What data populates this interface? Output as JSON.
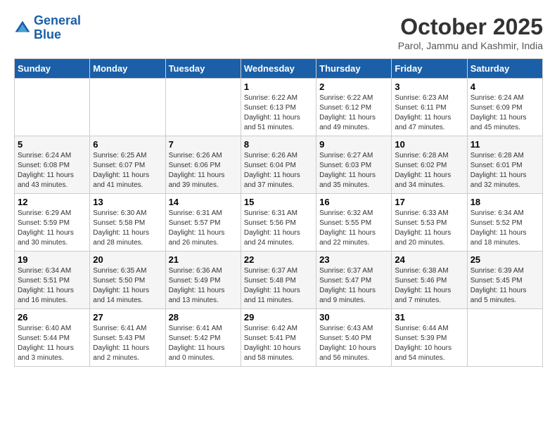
{
  "header": {
    "logo_line1": "General",
    "logo_line2": "Blue",
    "month": "October 2025",
    "location": "Parol, Jammu and Kashmir, India"
  },
  "weekdays": [
    "Sunday",
    "Monday",
    "Tuesday",
    "Wednesday",
    "Thursday",
    "Friday",
    "Saturday"
  ],
  "weeks": [
    [
      {
        "day": "",
        "sunrise": "",
        "sunset": "",
        "daylight": ""
      },
      {
        "day": "",
        "sunrise": "",
        "sunset": "",
        "daylight": ""
      },
      {
        "day": "",
        "sunrise": "",
        "sunset": "",
        "daylight": ""
      },
      {
        "day": "1",
        "sunrise": "Sunrise: 6:22 AM",
        "sunset": "Sunset: 6:13 PM",
        "daylight": "Daylight: 11 hours and 51 minutes."
      },
      {
        "day": "2",
        "sunrise": "Sunrise: 6:22 AM",
        "sunset": "Sunset: 6:12 PM",
        "daylight": "Daylight: 11 hours and 49 minutes."
      },
      {
        "day": "3",
        "sunrise": "Sunrise: 6:23 AM",
        "sunset": "Sunset: 6:11 PM",
        "daylight": "Daylight: 11 hours and 47 minutes."
      },
      {
        "day": "4",
        "sunrise": "Sunrise: 6:24 AM",
        "sunset": "Sunset: 6:09 PM",
        "daylight": "Daylight: 11 hours and 45 minutes."
      }
    ],
    [
      {
        "day": "5",
        "sunrise": "Sunrise: 6:24 AM",
        "sunset": "Sunset: 6:08 PM",
        "daylight": "Daylight: 11 hours and 43 minutes."
      },
      {
        "day": "6",
        "sunrise": "Sunrise: 6:25 AM",
        "sunset": "Sunset: 6:07 PM",
        "daylight": "Daylight: 11 hours and 41 minutes."
      },
      {
        "day": "7",
        "sunrise": "Sunrise: 6:26 AM",
        "sunset": "Sunset: 6:06 PM",
        "daylight": "Daylight: 11 hours and 39 minutes."
      },
      {
        "day": "8",
        "sunrise": "Sunrise: 6:26 AM",
        "sunset": "Sunset: 6:04 PM",
        "daylight": "Daylight: 11 hours and 37 minutes."
      },
      {
        "day": "9",
        "sunrise": "Sunrise: 6:27 AM",
        "sunset": "Sunset: 6:03 PM",
        "daylight": "Daylight: 11 hours and 35 minutes."
      },
      {
        "day": "10",
        "sunrise": "Sunrise: 6:28 AM",
        "sunset": "Sunset: 6:02 PM",
        "daylight": "Daylight: 11 hours and 34 minutes."
      },
      {
        "day": "11",
        "sunrise": "Sunrise: 6:28 AM",
        "sunset": "Sunset: 6:01 PM",
        "daylight": "Daylight: 11 hours and 32 minutes."
      }
    ],
    [
      {
        "day": "12",
        "sunrise": "Sunrise: 6:29 AM",
        "sunset": "Sunset: 5:59 PM",
        "daylight": "Daylight: 11 hours and 30 minutes."
      },
      {
        "day": "13",
        "sunrise": "Sunrise: 6:30 AM",
        "sunset": "Sunset: 5:58 PM",
        "daylight": "Daylight: 11 hours and 28 minutes."
      },
      {
        "day": "14",
        "sunrise": "Sunrise: 6:31 AM",
        "sunset": "Sunset: 5:57 PM",
        "daylight": "Daylight: 11 hours and 26 minutes."
      },
      {
        "day": "15",
        "sunrise": "Sunrise: 6:31 AM",
        "sunset": "Sunset: 5:56 PM",
        "daylight": "Daylight: 11 hours and 24 minutes."
      },
      {
        "day": "16",
        "sunrise": "Sunrise: 6:32 AM",
        "sunset": "Sunset: 5:55 PM",
        "daylight": "Daylight: 11 hours and 22 minutes."
      },
      {
        "day": "17",
        "sunrise": "Sunrise: 6:33 AM",
        "sunset": "Sunset: 5:53 PM",
        "daylight": "Daylight: 11 hours and 20 minutes."
      },
      {
        "day": "18",
        "sunrise": "Sunrise: 6:34 AM",
        "sunset": "Sunset: 5:52 PM",
        "daylight": "Daylight: 11 hours and 18 minutes."
      }
    ],
    [
      {
        "day": "19",
        "sunrise": "Sunrise: 6:34 AM",
        "sunset": "Sunset: 5:51 PM",
        "daylight": "Daylight: 11 hours and 16 minutes."
      },
      {
        "day": "20",
        "sunrise": "Sunrise: 6:35 AM",
        "sunset": "Sunset: 5:50 PM",
        "daylight": "Daylight: 11 hours and 14 minutes."
      },
      {
        "day": "21",
        "sunrise": "Sunrise: 6:36 AM",
        "sunset": "Sunset: 5:49 PM",
        "daylight": "Daylight: 11 hours and 13 minutes."
      },
      {
        "day": "22",
        "sunrise": "Sunrise: 6:37 AM",
        "sunset": "Sunset: 5:48 PM",
        "daylight": "Daylight: 11 hours and 11 minutes."
      },
      {
        "day": "23",
        "sunrise": "Sunrise: 6:37 AM",
        "sunset": "Sunset: 5:47 PM",
        "daylight": "Daylight: 11 hours and 9 minutes."
      },
      {
        "day": "24",
        "sunrise": "Sunrise: 6:38 AM",
        "sunset": "Sunset: 5:46 PM",
        "daylight": "Daylight: 11 hours and 7 minutes."
      },
      {
        "day": "25",
        "sunrise": "Sunrise: 6:39 AM",
        "sunset": "Sunset: 5:45 PM",
        "daylight": "Daylight: 11 hours and 5 minutes."
      }
    ],
    [
      {
        "day": "26",
        "sunrise": "Sunrise: 6:40 AM",
        "sunset": "Sunset: 5:44 PM",
        "daylight": "Daylight: 11 hours and 3 minutes."
      },
      {
        "day": "27",
        "sunrise": "Sunrise: 6:41 AM",
        "sunset": "Sunset: 5:43 PM",
        "daylight": "Daylight: 11 hours and 2 minutes."
      },
      {
        "day": "28",
        "sunrise": "Sunrise: 6:41 AM",
        "sunset": "Sunset: 5:42 PM",
        "daylight": "Daylight: 11 hours and 0 minutes."
      },
      {
        "day": "29",
        "sunrise": "Sunrise: 6:42 AM",
        "sunset": "Sunset: 5:41 PM",
        "daylight": "Daylight: 10 hours and 58 minutes."
      },
      {
        "day": "30",
        "sunrise": "Sunrise: 6:43 AM",
        "sunset": "Sunset: 5:40 PM",
        "daylight": "Daylight: 10 hours and 56 minutes."
      },
      {
        "day": "31",
        "sunrise": "Sunrise: 6:44 AM",
        "sunset": "Sunset: 5:39 PM",
        "daylight": "Daylight: 10 hours and 54 minutes."
      },
      {
        "day": "",
        "sunrise": "",
        "sunset": "",
        "daylight": ""
      }
    ]
  ]
}
